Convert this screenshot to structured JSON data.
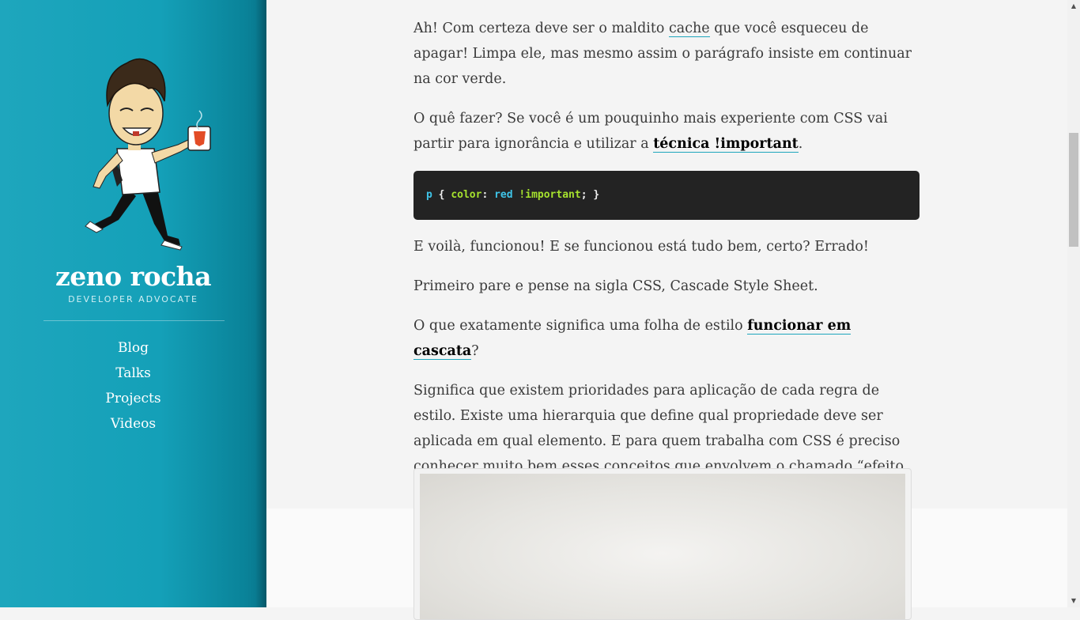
{
  "sidebar": {
    "title": "zeno rocha",
    "subtitle": "DEVELOPER ADVOCATE",
    "nav": [
      {
        "label": "Blog"
      },
      {
        "label": "Talks"
      },
      {
        "label": "Projects"
      },
      {
        "label": "Videos"
      }
    ],
    "colors": {
      "accent": "#1ea6bd",
      "dark": "#08748a"
    }
  },
  "article": {
    "p1_a": "Ah! Com certeza deve ser o maldito ",
    "p1_link": "cache",
    "p1_b": " que você esqueceu de apagar! Limpa ele, mas mesmo assim o parágrafo insiste em continuar na cor verde.",
    "p2_a": "O quê fazer? Se você é um pouquinho mais experiente com CSS vai partir para ignorância e utilizar a ",
    "p2_link": "técnica !important",
    "p2_b": ".",
    "code": {
      "selector": "p",
      "open": " { ",
      "property": "color",
      "colon": ": ",
      "value": "red",
      "space": " ",
      "important": "!important",
      "close": "; }"
    },
    "p3": "E voilà, funcionou! E se funcionou está tudo bem, certo? Errado!",
    "p4": "Primeiro pare e pense na sigla CSS, Cascade Style Sheet.",
    "p5_a": "O que exatamente significa uma folha de estilo ",
    "p5_link": "funcionar em cascata",
    "p5_b": "?",
    "p6": "Significa que existem prioridades para aplicação de cada regra de estilo. Existe uma hierarquia que define qual propriedade deve ser aplicada em qual elemento. E para quem trabalha com CSS é preciso conhecer muito bem esses conceitos que envolvem o chamado “efeito cascata”."
  },
  "icons": {
    "avatar": "cartoon-developer-with-mug-avatar",
    "scroll_up": "arrow-up-icon",
    "scroll_down": "arrow-down-icon"
  }
}
